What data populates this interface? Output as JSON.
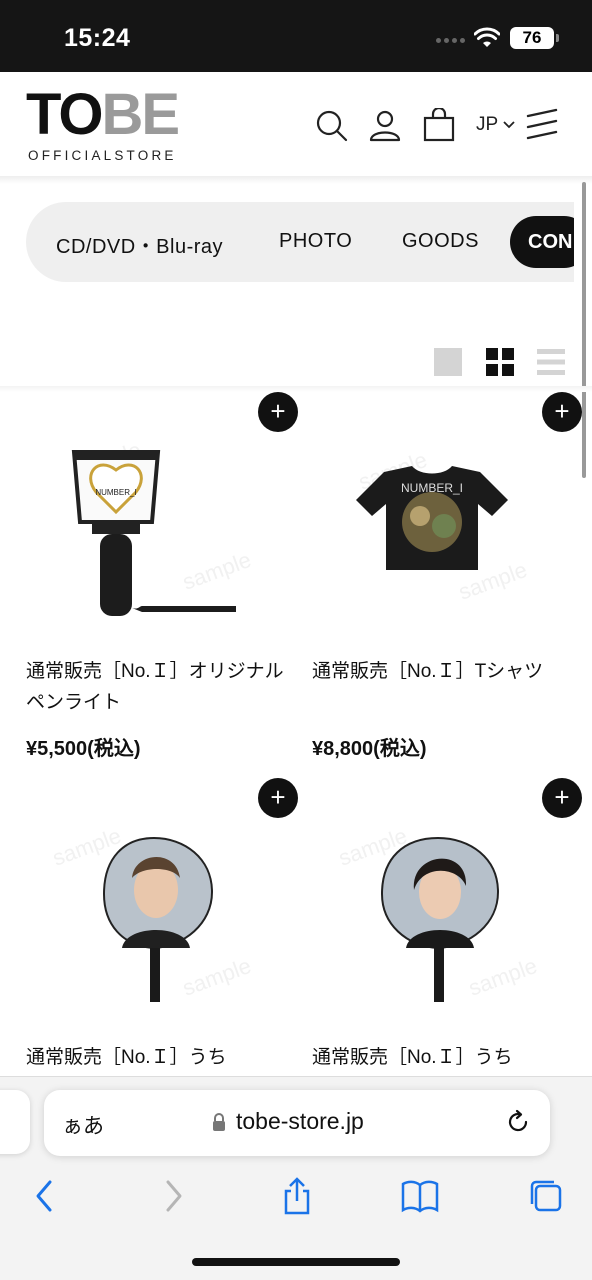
{
  "status": {
    "time": "15:24",
    "battery": "76"
  },
  "header": {
    "logo_main_1": "TO",
    "logo_main_2": "BE",
    "logo_sub": "OFFICIALSTORE",
    "lang": "JP",
    "icons": [
      "search-icon",
      "account-icon",
      "cart-icon",
      "chevron-down-icon",
      "menu-icon"
    ]
  },
  "categories": [
    {
      "label": "CD/DVD・Blu-ray"
    },
    {
      "label": "PHOTO"
    },
    {
      "label": "GOODS"
    },
    {
      "label": "CON",
      "active": true
    }
  ],
  "view_options": [
    "single-view-icon",
    "grid-view-icon",
    "list-view-icon"
  ],
  "products": [
    {
      "title": "通常販売［No.Ｉ］オリジナルペンライト",
      "price": "¥5,500(税込)"
    },
    {
      "title": "通常販売［No.Ｉ］Tシャツ",
      "price": "¥8,800(税込)"
    },
    {
      "title": "通常販売［No.Ｉ］うち",
      "price": ""
    },
    {
      "title": "通常販売［No.Ｉ］うち",
      "price": ""
    }
  ],
  "product_image_text": {
    "penlight_label": "NUMBER_I",
    "shirt_print": "NUMBER_I",
    "watermark": "sample"
  },
  "browser": {
    "text_size": "ぁあ",
    "url": "tobe-store.jp"
  },
  "colors": {
    "black": "#111111",
    "gray_bar": "#efefef",
    "status_bg": "#151515",
    "accent_link": "#1a73e8"
  }
}
